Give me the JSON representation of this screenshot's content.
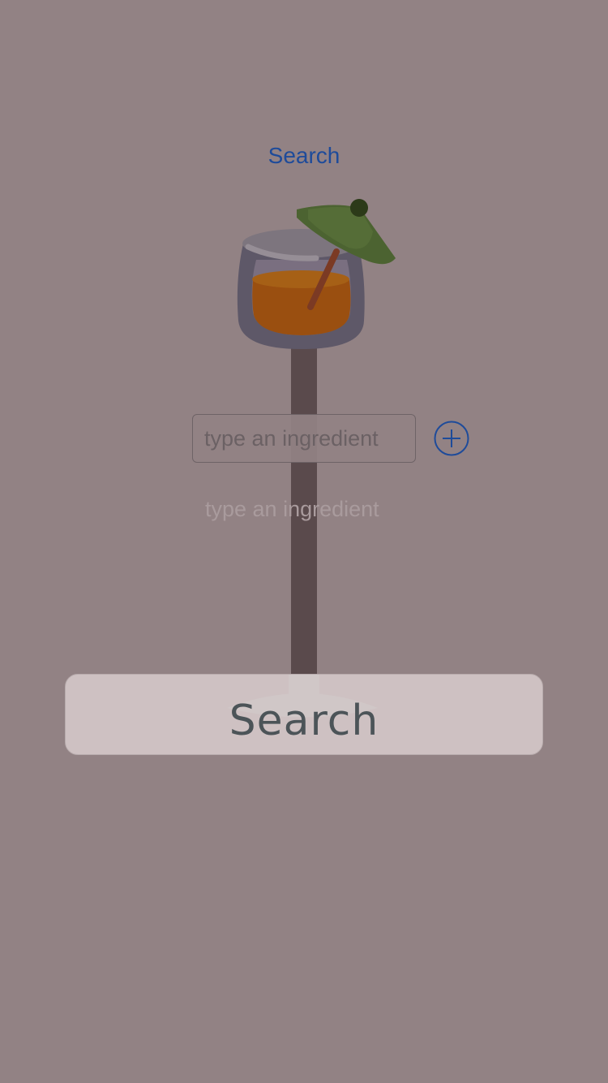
{
  "nav": {
    "title": "Search"
  },
  "illustration": {
    "icon": "cocktail-glass-icon",
    "colors": {
      "stem": "#5a4a4c",
      "glass": "#5f5869",
      "drink": "#9a4f12",
      "umbrella": "#4c6331",
      "base": "#9b9fa3"
    }
  },
  "ingredient": {
    "placeholder": "type an ingredient",
    "hint": "type an ingredient"
  },
  "add_button": {
    "icon": "plus-circle-icon",
    "color": "#1e4b9a"
  },
  "search_button": {
    "label": "Search"
  },
  "colors": {
    "background": "#928284",
    "accent": "#1e4b9a"
  }
}
